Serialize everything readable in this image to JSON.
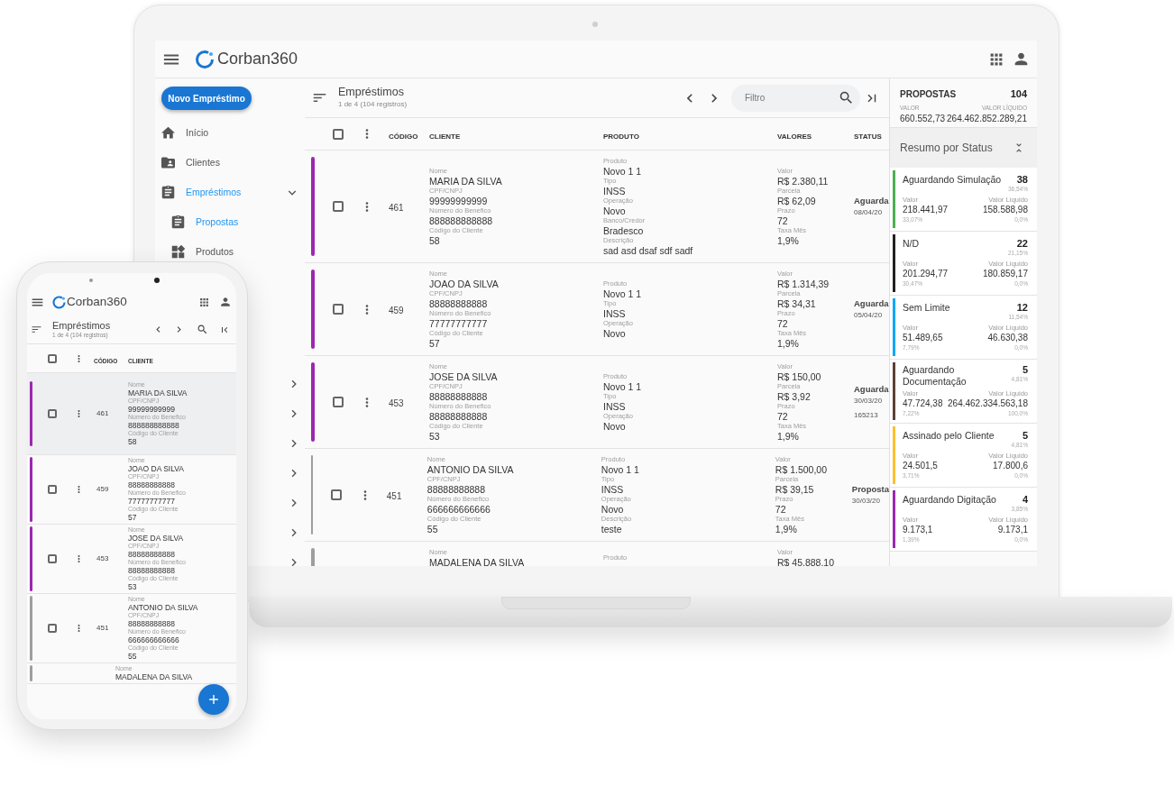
{
  "laptop": {
    "app_bar": {
      "logo": "Corban360"
    },
    "sidebar": {
      "new_button": "Novo Empréstimo",
      "items": [
        {
          "kind": "home",
          "label": "Início",
          "selected": false
        },
        {
          "kind": "clients",
          "label": "Clientes",
          "selected": false
        },
        {
          "kind": "loans",
          "label": "Empréstimos",
          "selected": true,
          "expanded": true,
          "children": [
            {
              "kind": "proposals",
              "label": "Propostas",
              "selected": true
            },
            {
              "kind": "products",
              "label": "Produtos",
              "selected": false
            }
          ]
        }
      ]
    },
    "list": {
      "title": "Empréstimos",
      "subtitle": "1 de 4 (104 registros)",
      "filter": {
        "placeholder": "Filtro"
      },
      "columns": [
        "CÓDIGO",
        "CLIENTE",
        "PRODUTO",
        "VALORES",
        "STATUS"
      ],
      "all_checked": false,
      "rows": [
        {
          "color": "#9c27b0",
          "checked": false,
          "code": "461",
          "cliente": [
            {
              "label": "Nome",
              "value": "MARIA DA SILVA"
            },
            {
              "label": "CPF/CNPJ",
              "value": "99999999999"
            },
            {
              "label": "Número do Benefico",
              "value": "888888888888"
            },
            {
              "label": "Código do Cliente",
              "value": "58"
            }
          ],
          "produto": [
            {
              "label": "Produto",
              "value": "Novo 1 1"
            },
            {
              "label": "Tipo",
              "value": "INSS"
            },
            {
              "label": "Operação",
              "value": "Novo"
            },
            {
              "label": "Banco/Credor",
              "value": "Bradesco"
            },
            {
              "label": "Descrição",
              "value": "sad asd dsaf sdf sadf"
            }
          ],
          "valores": [
            {
              "label": "Valor",
              "value": "R$ 2.380,11"
            },
            {
              "label": "Parcela",
              "value": "R$ 62,09"
            },
            {
              "label": "Prazo",
              "value": "72"
            },
            {
              "label": "Taxa Mês",
              "value": "1,9%"
            }
          ],
          "status": {
            "title": "Aguarda",
            "date": "08/04/20"
          }
        },
        {
          "color": "#9c27b0",
          "checked": false,
          "code": "459",
          "cliente": [
            {
              "label": "Nome",
              "value": "JOAO DA SILVA"
            },
            {
              "label": "CPF/CNPJ",
              "value": "88888888888"
            },
            {
              "label": "Número do Benefico",
              "value": "77777777777"
            },
            {
              "label": "Código do Cliente",
              "value": "57"
            }
          ],
          "produto": [
            {
              "label": "Produto",
              "value": "Novo 1 1"
            },
            {
              "label": "Tipo",
              "value": "INSS"
            },
            {
              "label": "Operação",
              "value": "Novo"
            }
          ],
          "valores": [
            {
              "label": "Valor",
              "value": "R$ 1.314,39"
            },
            {
              "label": "Parcela",
              "value": "R$ 34,31"
            },
            {
              "label": "Prazo",
              "value": "72"
            },
            {
              "label": "Taxa Mês",
              "value": "1,9%"
            }
          ],
          "status": {
            "title": "Aguarda",
            "date": "05/04/20"
          }
        },
        {
          "color": "#9c27b0",
          "checked": false,
          "code": "453",
          "cliente": [
            {
              "label": "Nome",
              "value": "JOSE DA SILVA"
            },
            {
              "label": "CPF/CNPJ",
              "value": "88888888888"
            },
            {
              "label": "Número do Benefico",
              "value": "88888888888"
            },
            {
              "label": "Código do Cliente",
              "value": "53"
            }
          ],
          "produto": [
            {
              "label": "Produto",
              "value": "Novo 1 1"
            },
            {
              "label": "Tipo",
              "value": "INSS"
            },
            {
              "label": "Operação",
              "value": "Novo"
            }
          ],
          "valores": [
            {
              "label": "Valor",
              "value": "R$ 150,00"
            },
            {
              "label": "Parcela",
              "value": "R$ 3,92"
            },
            {
              "label": "Prazo",
              "value": "72"
            },
            {
              "label": "Taxa Mês",
              "value": "1,9%"
            }
          ],
          "status": {
            "title": "Aguarda",
            "date": "30/03/20",
            "extra": "165213"
          }
        },
        {
          "color": "#9e9e9e",
          "checked": false,
          "code": "451",
          "cliente": [
            {
              "label": "Nome",
              "value": "ANTONIO DA SILVA"
            },
            {
              "label": "CPF/CNPJ",
              "value": "88888888888"
            },
            {
              "label": "Número do Benefico",
              "value": "666666666666"
            },
            {
              "label": "Código do Cliente",
              "value": "55"
            }
          ],
          "produto": [
            {
              "label": "Produto",
              "value": "Novo 1 1"
            },
            {
              "label": "Tipo",
              "value": "INSS"
            },
            {
              "label": "Operação",
              "value": "Novo"
            },
            {
              "label": "Descrição",
              "value": "teste"
            }
          ],
          "valores": [
            {
              "label": "Valor",
              "value": "R$ 1.500,00"
            },
            {
              "label": "Parcela",
              "value": "R$ 39,15"
            },
            {
              "label": "Prazo",
              "value": "72"
            },
            {
              "label": "Taxa Mês",
              "value": "1,9%"
            }
          ],
          "status": {
            "title": "Proposta",
            "date": "30/03/20"
          }
        },
        {
          "color": "#9e9e9e",
          "cliente": [
            {
              "label": "Nome",
              "value": "MADALENA DA SILVA"
            }
          ],
          "produto": [
            {
              "label": "Produto"
            }
          ],
          "valores": [
            {
              "label": "Valor",
              "value": "R$ 45.888,10"
            }
          ]
        }
      ]
    },
    "summary": {
      "title": "PROPOSTAS",
      "count": "104",
      "valor_label": "VALOR",
      "valor": "660.552,73",
      "liquido_label": "VALOR LÍQUIDO",
      "liquido": "264.462.852.289,21",
      "section_title": "Resumo por Status",
      "cards": [
        {
          "color": "#4caf50",
          "label": "Aguardando Simulação",
          "count": "38",
          "share": "36,54%",
          "valor_label": "Valor",
          "valor": "218.441,97",
          "valor_share": "33,07%",
          "liquido_label": "Valor Líquido",
          "liquido": "158.588,98",
          "liquido_share": "0,0%"
        },
        {
          "color": "#212121",
          "label": "N/D",
          "count": "22",
          "share": "21,15%",
          "valor_label": "Valor",
          "valor": "201.294,77",
          "valor_share": "30,47%",
          "liquido_label": "Valor Líquido",
          "liquido": "180.859,17",
          "liquido_share": "0,0%"
        },
        {
          "color": "#03a9f4",
          "label": "Sem Limite",
          "count": "12",
          "share": "11,54%",
          "valor_label": "Valor",
          "valor": "51.489,65",
          "valor_share": "7,79%",
          "liquido_label": "Valor Líquido",
          "liquido": "46.630,38",
          "liquido_share": "0,0%"
        },
        {
          "color": "#5d4037",
          "label": "Aguardando Documentação",
          "count": "5",
          "share": "4,81%",
          "valor_label": "Valor",
          "valor": "47.724,38",
          "valor_share": "7,22%",
          "liquido_label": "Valor Líquido",
          "liquido": "264.462.334.563,18",
          "liquido_share": "100,0%"
        },
        {
          "color": "#fbc02d",
          "label": "Assinado pelo Cliente",
          "count": "5",
          "share": "4,81%",
          "valor_label": "Valor",
          "valor": "24.501,5",
          "valor_share": "3,71%",
          "liquido_label": "Valor Líquido",
          "liquido": "17.800,6",
          "liquido_share": "0,0%"
        },
        {
          "color": "#9c27b0",
          "label": "Aguardando Digitação",
          "count": "4",
          "share": "3,85%",
          "valor_label": "Valor",
          "valor": "9.173,1",
          "valor_share": "1,39%",
          "liquido_label": "Valor Líquido",
          "liquido": "9.173,1",
          "liquido_share": "0,0%"
        }
      ]
    }
  },
  "phone": {
    "app_bar": {
      "logo": "Corban360"
    },
    "list": {
      "title": "Empréstimos",
      "subtitle": "1 de 4 (104 registros)",
      "columns": [
        "CÓDIGO",
        "CLIENTE"
      ],
      "all_checked": false,
      "rows": [
        {
          "color": "#9c27b0",
          "selected": true,
          "checked": false,
          "code": "461",
          "cliente": [
            {
              "label": "Nome",
              "value": "MARIA DA SILVA"
            },
            {
              "label": "CPF/CNPJ",
              "value": "99999999999"
            },
            {
              "label": "Número do Benefico",
              "value": "888888888888"
            },
            {
              "label": "Código do Cliente",
              "value": "58"
            }
          ]
        },
        {
          "color": "#9c27b0",
          "selected": false,
          "checked": false,
          "code": "459",
          "cliente": [
            {
              "label": "Nome",
              "value": "JOAO DA SILVA"
            },
            {
              "label": "CPF/CNPJ",
              "value": "88888888888"
            },
            {
              "label": "Número do Benefico",
              "value": "77777777777"
            },
            {
              "label": "Código do Cliente",
              "value": "57"
            }
          ]
        },
        {
          "color": "#9c27b0",
          "selected": false,
          "checked": false,
          "code": "453",
          "cliente": [
            {
              "label": "Nome",
              "value": "JOSE DA SILVA"
            },
            {
              "label": "CPF/CNPJ",
              "value": "88888888888"
            },
            {
              "label": "Número do Benefico",
              "value": "88888888888"
            },
            {
              "label": "Código do Cliente",
              "value": "53"
            }
          ]
        },
        {
          "color": "#9e9e9e",
          "selected": false,
          "checked": false,
          "code": "451",
          "cliente": [
            {
              "label": "Nome",
              "value": "ANTONIO DA SILVA"
            },
            {
              "label": "CPF/CNPJ",
              "value": "88888888888"
            },
            {
              "label": "Número do Benefico",
              "value": "666666666666"
            },
            {
              "label": "Código do Cliente",
              "value": "55"
            }
          ]
        },
        {
          "color": "#9e9e9e",
          "selected": false,
          "cliente": [
            {
              "label": "Nome",
              "value": "MADALENA DA SILVA"
            }
          ]
        }
      ]
    }
  }
}
